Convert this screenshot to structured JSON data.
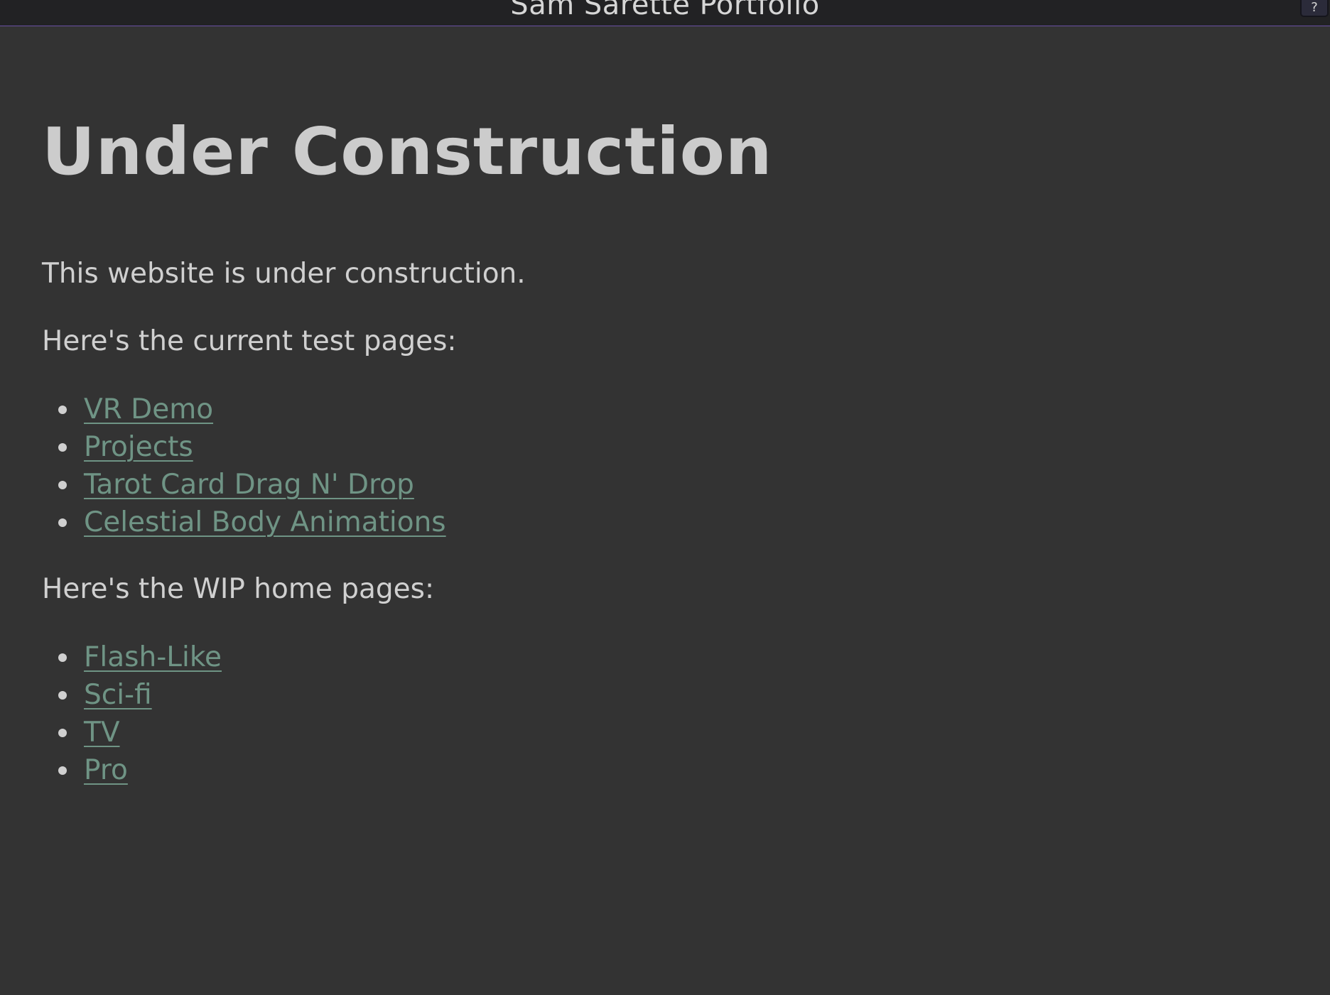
{
  "header": {
    "site_title": "Sam Sarette Portfolio",
    "help_label": "?"
  },
  "main": {
    "title": "Under Construction",
    "intro": "This website is under construction.",
    "test_heading": "Here's the current test pages:",
    "test_links": [
      {
        "label": "VR Demo"
      },
      {
        "label": "Projects"
      },
      {
        "label": "Tarot Card Drag N' Drop"
      },
      {
        "label": "Celestial Body Animations"
      }
    ],
    "wip_heading": "Here's the WIP home pages:",
    "wip_links": [
      {
        "label": "Flash-Like"
      },
      {
        "label": "Sci-fi"
      },
      {
        "label": "TV"
      },
      {
        "label": "Pro"
      }
    ]
  },
  "colors": {
    "background": "#333333",
    "header_background": "#222224",
    "header_border": "#6a4fa3",
    "text": "#d0d0d0",
    "link": "#6f9485"
  }
}
